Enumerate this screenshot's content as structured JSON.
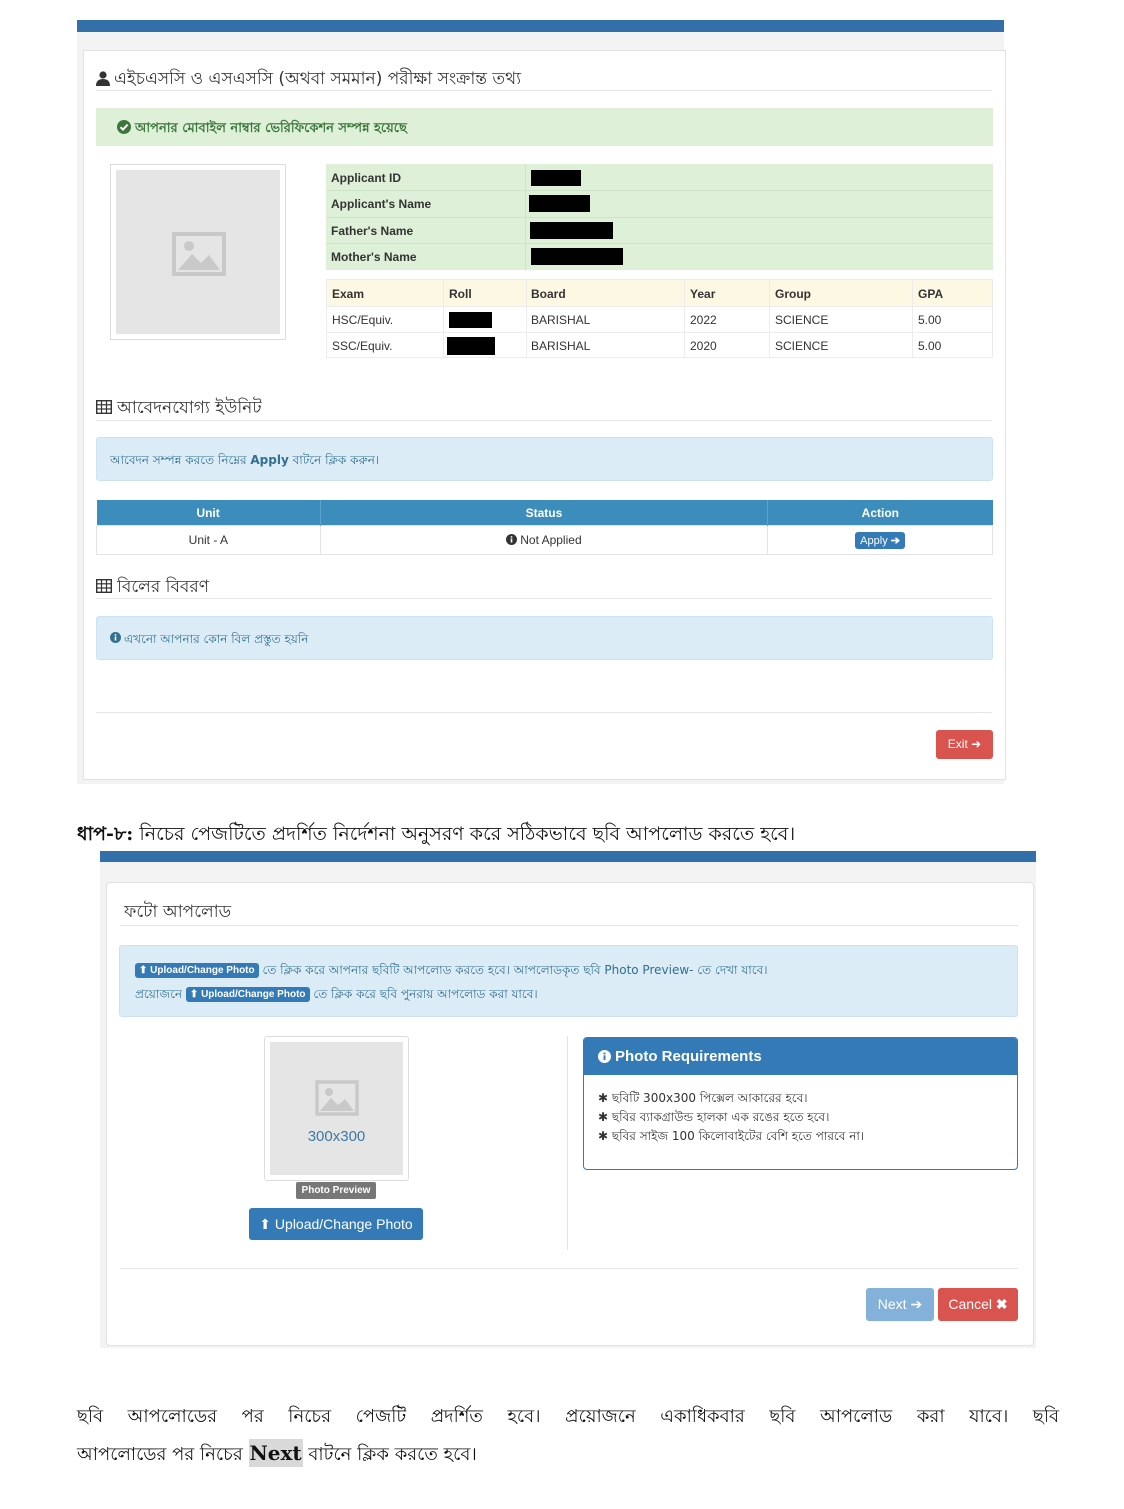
{
  "app_panel": {
    "section_title": "এইচএসসি ও এসএসসি (অথবা সমমান) পরীক্ষা সংক্রান্ত তথ্য",
    "verification_message": "আপনার মোবাইল নাম্বার ভেরিফিকেশন সম্পন্ন হয়েছে",
    "info_labels": [
      "Applicant ID",
      "Applicant's Name",
      "Father's Name",
      "Mother's Name"
    ],
    "exam_table": {
      "headers": [
        "Exam",
        "Roll",
        "Board",
        "Year",
        "Group",
        "GPA"
      ],
      "rows": [
        {
          "exam": "HSC/Equiv.",
          "board": "BARISHAL",
          "year": "2022",
          "group": "SCIENCE",
          "gpa": "5.00"
        },
        {
          "exam": "SSC/Equiv.",
          "board": "BARISHAL",
          "year": "2020",
          "group": "SCIENCE",
          "gpa": "5.00"
        }
      ]
    },
    "units_title": "আবেদনযোগ্য ইউনিট",
    "units_info": {
      "before": "আবেদন সম্পন্ন করতে নিম্নের ",
      "bold": "Apply",
      "after": " বাটনে ক্লিক করুন।"
    },
    "units_table": {
      "headers": [
        "Unit",
        "Status",
        "Action"
      ],
      "row": {
        "unit": "Unit - A",
        "status": "Not Applied",
        "action": "Apply"
      }
    },
    "bill_title": "বিলের বিবরণ",
    "bill_info": "এখনো আপনার কোন বিল প্রস্তুত হয়নি",
    "exit_label": "Exit"
  },
  "step": {
    "bold": "ধাপ-৮:",
    "text": " নিচের পেজটিতে প্রদর্শিত নির্দেশনা অনুসরণ করে সঠিকভাবে ছবি আপলোড করতে হবে।"
  },
  "photo_panel": {
    "title": "ফটো আপলোড",
    "info_line1": "তে ক্লিক করে আপনার ছবিটি আপলোড করতে হবে। আপলোডকৃত ছবি Photo Preview- তে দেখা যাবে।",
    "info_line2_prefix": "প্রয়োজনে",
    "info_line2_suffix": "তে ক্লিক করে ছবি পুনরায় আপলোড করা যাবে।",
    "inline_button": "Upload/Change Photo",
    "placeholder_text": "300x300",
    "preview_label": "Photo Preview",
    "upload_button": "Upload/Change Photo",
    "requirements_title": "Photo Requirements",
    "requirements": [
      "ছবিটি 300x300 পিক্সেল আকারের হবে।",
      "ছবির ব্যাকগ্রাউন্ড হালকা এক রঙের হতে হবে।",
      "ছবির সাইজ 100 কিলোবাইটের বেশি হতে পারবে না।"
    ],
    "next_label": "Next",
    "cancel_label": "Cancel"
  },
  "footer": {
    "line1": "ছবি আপলোডের পর নিচের পেজটি প্রদর্শিত হবে। প্রয়োজনে একাধিকবার ছবি আপলোড করা যাবে। ছবি",
    "line2_before": "আপলোডের পর নিচের ",
    "line2_bold": "Next",
    "line2_after": " বাটনে ক্লিক করতে হবে।"
  },
  "colors": {
    "primary": "#337ab7",
    "header_bar": "#336fa8",
    "success_bg": "#dff0d8",
    "info_bg": "#dcecf6",
    "danger": "#d9534f"
  }
}
